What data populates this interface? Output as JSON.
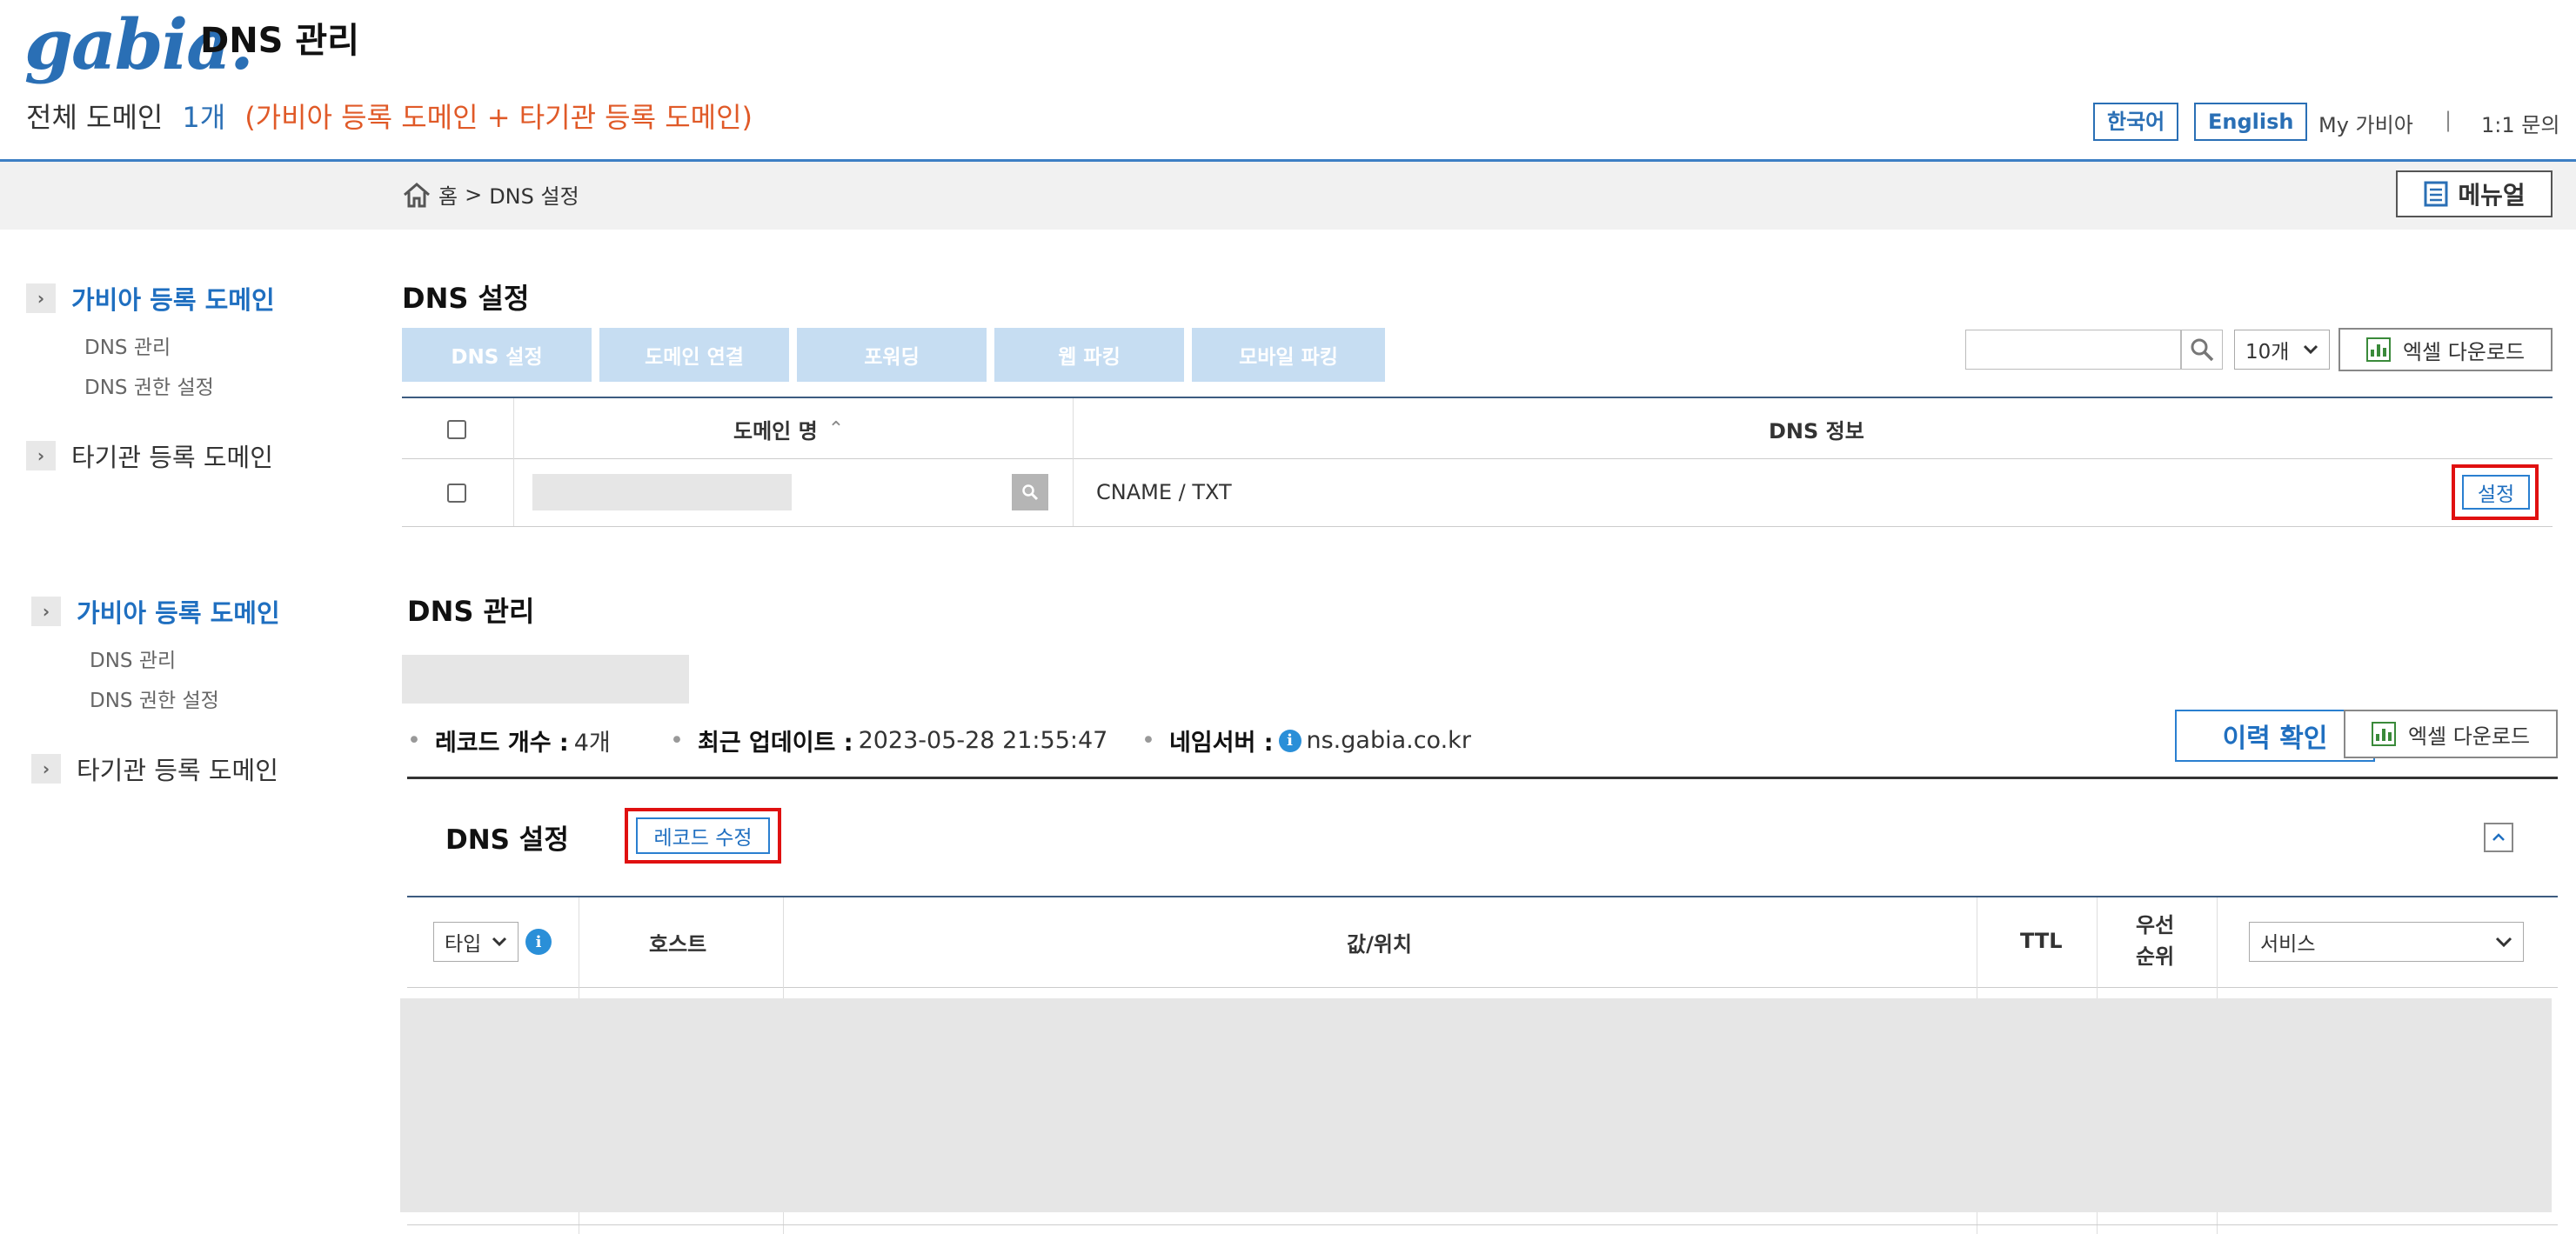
{
  "header": {
    "logo": "gabia.",
    "title": "DNS 관리",
    "summary_label": "전체 도메인",
    "summary_count": "1개",
    "summary_note": "(가비아 등록 도메인 + 타기관 등록 도메인)",
    "lang_korean": "한국어",
    "lang_english": "English",
    "my_gabia": "My 가비아",
    "separator": "|",
    "inquiry": "1:1 문의"
  },
  "breadcrumb": {
    "home": "홈",
    "sep": ">",
    "current": "DNS 설정"
  },
  "manual_button": "메뉴얼",
  "sidebar": {
    "gabia_domains": "가비아 등록 도메인",
    "dns_manage": "DNS 관리",
    "dns_permission": "DNS 권한 설정",
    "other_domains": "타기관 등록 도메인"
  },
  "dns_settings": {
    "title": "DNS 설정",
    "tabs": [
      "DNS 설정",
      "도메인 연결",
      "포워딩",
      "웹 파킹",
      "모바일 파킹"
    ],
    "page_size": "10개",
    "excel_download": "엑셀 다운로드",
    "col_domain": "도메인 명",
    "sort_icon": "⌃",
    "col_dns_info": "DNS 정보",
    "row_dns_info": "CNAME / TXT",
    "row_button": "설정"
  },
  "dns_manage": {
    "title": "DNS 관리",
    "record_count_label": "레코드 개수 :",
    "record_count_value": "4개",
    "last_update_label": "최근 업데이트 :",
    "last_update_value": "2023-05-28 21:55:47",
    "nameserver_label": "네임서버 :",
    "nameserver_value": "ns.gabia.co.kr",
    "history_button": "이력 확인",
    "excel_download": "엑셀 다운로드",
    "sub_title": "DNS 설정",
    "edit_records_button": "레코드 수정",
    "collapse_icon": "^",
    "type_select": "타입",
    "col_host": "호스트",
    "col_value": "값/위치",
    "col_ttl": "TTL",
    "col_priority_1": "우선",
    "col_priority_2": "순위",
    "service_select": "서비스"
  }
}
